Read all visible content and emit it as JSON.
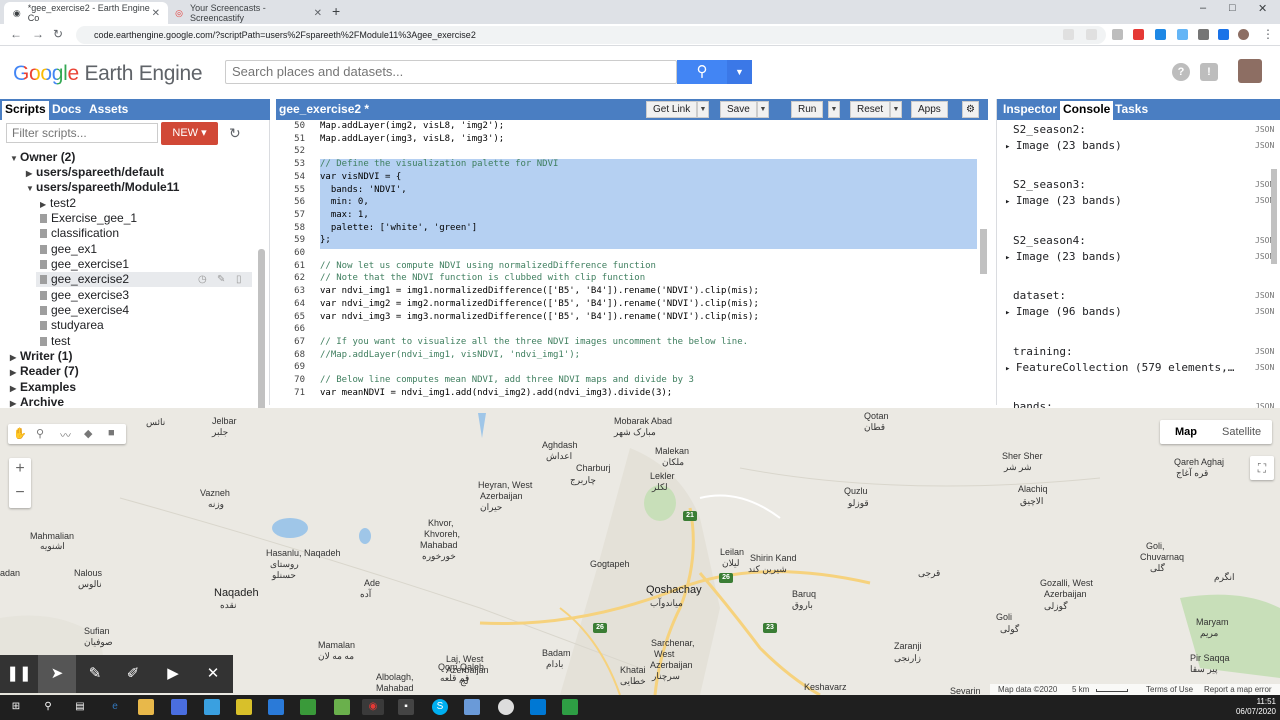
{
  "browser": {
    "tabs": [
      {
        "title": "*gee_exercise2 - Earth Engine Co",
        "active": true
      },
      {
        "title": "Your Screencasts - Screencastify",
        "active": false
      }
    ],
    "url": "code.earthengine.google.com/?scriptPath=users%2Fspareeth%2FModule11%3Agee_exercise2",
    "window_controls": [
      "–",
      "□",
      "✕"
    ]
  },
  "header": {
    "logo_word1": "Google",
    "logo_word2": "Earth Engine",
    "search_placeholder": "Search places and datasets..."
  },
  "left_panel": {
    "tabs": [
      "Scripts",
      "Docs",
      "Assets"
    ],
    "active_tab": "Scripts",
    "filter_placeholder": "Filter scripts...",
    "new_button": "NEW ▾",
    "tree": [
      {
        "label": "Owner",
        "count": "(2)",
        "expanded": true
      },
      {
        "label": "users/spareeth/default",
        "expanded": false
      },
      {
        "label": "users/spareeth/Module11",
        "expanded": true
      },
      {
        "label": "test2",
        "expanded": false
      },
      {
        "label": "Exercise_gee_1"
      },
      {
        "label": "classification"
      },
      {
        "label": "gee_ex1"
      },
      {
        "label": "gee_exercise1"
      },
      {
        "label": "gee_exercise2",
        "selected": true
      },
      {
        "label": "gee_exercise3"
      },
      {
        "label": "gee_exercise4"
      },
      {
        "label": "studyarea"
      },
      {
        "label": "test"
      },
      {
        "label": "Writer",
        "count": "(1)",
        "expanded": false
      },
      {
        "label": "Reader",
        "count": "(7)",
        "expanded": false
      },
      {
        "label": "Examples",
        "expanded": false
      },
      {
        "label": "Archive",
        "expanded": false
      }
    ]
  },
  "editor": {
    "title": "gee_exercise2 *",
    "buttons": [
      "Get Link",
      "Save",
      "Run",
      "Reset",
      "Apps"
    ],
    "lines": [
      {
        "n": "50",
        "text": "Map.addLayer(img2, visL8, 'img2');"
      },
      {
        "n": "51",
        "text": "Map.addLayer(img3, visL8, 'img3');"
      },
      {
        "n": "52",
        "text": ""
      },
      {
        "n": "53",
        "text": "// Define the visualization palette for NDVI"
      },
      {
        "n": "54",
        "text": "var visNDVI = {"
      },
      {
        "n": "55",
        "text": "  bands: 'NDVI',"
      },
      {
        "n": "56",
        "text": "  min: 0,"
      },
      {
        "n": "57",
        "text": "  max: 1,"
      },
      {
        "n": "58",
        "text": "  palette: ['white', 'green']"
      },
      {
        "n": "59",
        "text": "};"
      },
      {
        "n": "60",
        "text": ""
      },
      {
        "n": "61",
        "text": "// Now let us compute NDVI using normalizedDifference function"
      },
      {
        "n": "62",
        "text": "// Note that the NDVI function is clubbed with clip function"
      },
      {
        "n": "63",
        "text": "var ndvi_img1 = img1.normalizedDifference(['B5', 'B4']).rename('NDVI').clip(mis);"
      },
      {
        "n": "64",
        "text": "var ndvi_img2 = img2.normalizedDifference(['B5', 'B4']).rename('NDVI').clip(mis);"
      },
      {
        "n": "65",
        "text": "var ndvi_img3 = img3.normalizedDifference(['B5', 'B4']).rename('NDVI').clip(mis);"
      },
      {
        "n": "66",
        "text": ""
      },
      {
        "n": "67",
        "text": "// If you want to visualize all the three NDVI images uncomment the below line."
      },
      {
        "n": "68",
        "text": "//Map.addLayer(ndvi_img1, visNDVI, 'ndvi_img1');"
      },
      {
        "n": "69",
        "text": ""
      },
      {
        "n": "70",
        "text": "// Below line computes mean NDVI, add three NDVI maps and divide by 3"
      },
      {
        "n": "71",
        "text": "var meanNDVI = ndvi_img1.add(ndvi_img2).add(ndvi_img3).divide(3);"
      }
    ]
  },
  "right_panel": {
    "tabs": [
      "Inspector",
      "Console",
      "Tasks"
    ],
    "active_tab": "Console",
    "json_label": "JSON",
    "entries": [
      {
        "name": "S2_season2:",
        "value": "Image (23 bands)"
      },
      {
        "name": "S2_season3:",
        "value": "Image (23 bands)"
      },
      {
        "name": "S2_season4:",
        "value": "Image (23 bands)"
      },
      {
        "name": "dataset:",
        "value": "Image (96 bands)"
      },
      {
        "name": "training:",
        "value": "FeatureCollection (579 elements,…"
      },
      {
        "name": "bands:",
        "value": ""
      }
    ]
  },
  "map": {
    "type_buttons": [
      "Map",
      "Satellite"
    ],
    "active_type": "Map",
    "zoom_in": "+",
    "zoom_out": "−",
    "labels": [
      "Jelbar",
      "جلبر",
      "نائس",
      "Vazneh",
      "وزنه",
      "Mahmalian",
      "اشنویه",
      "Nalous",
      "نالوس",
      "adan",
      "Naqadeh",
      "نقده",
      "Hasanlu, Naqadeh",
      "روستای",
      "حسنلو",
      "Sufian",
      "صوفیان",
      "Mobarak Abad",
      "مبارک شهر",
      "Aghdash",
      "اعداش",
      "Heyran, West",
      "Azerbaijan",
      "حیران",
      "Charburj",
      "چاربرج",
      "Malekan",
      "ملکان",
      "Lekler",
      "لکلر",
      "Khvor,",
      "Khvoreh,",
      "Mahabad",
      "خورخوره",
      "Ade",
      "آده",
      "Gogtapeh",
      "Leilan",
      "لیلان",
      "Shirin Kand",
      "شیرین کند",
      "Qoshachay",
      "میاندوآب",
      "Baruq",
      "باروق",
      "Qotan",
      "قطان",
      "Sher Sher",
      "شر شر",
      "Qareh Aghaj",
      "قره آغاج",
      "Alachiq",
      "الاچیق",
      "Quzlu",
      "قوزلو",
      "Goli,",
      "Chuvarnaq",
      "گلی",
      "Gozalli, West",
      "Azerbaijan",
      "گوزلی",
      "Goli",
      "گولی",
      "Maryam",
      "مریم",
      "Pir Saqqa",
      "پیر سقا",
      "Zaranji",
      "زارنجی",
      "Keshavarz",
      "Sarchenar,",
      "West",
      "Azerbaijan",
      "سرچنار",
      "Khatai",
      "خطایی",
      "Badam",
      "بادام",
      "Laj, West",
      "Azerbaijan",
      "لج",
      "Qom Qaleh",
      "قم قلعه",
      "Albolagh,",
      "Mahabad",
      "Mamalan",
      "مه مه لان",
      "قرجی",
      "انگرم",
      "Sevarin"
    ],
    "road_shields": [
      "21",
      "26",
      "26",
      "23"
    ],
    "footer": [
      "Map data ©2020",
      "5 km",
      "Terms of Use",
      "Report a map error"
    ]
  },
  "recorder": {
    "buttons": [
      "pause",
      "cursor",
      "pen",
      "highlighter",
      "camera",
      "close"
    ]
  },
  "taskbar": {
    "time": "11:51",
    "date": "06/07/2020"
  },
  "colors": {
    "accent": "#4a7ec2",
    "new_button": "#d14836",
    "search_blue": "#4285f4"
  }
}
